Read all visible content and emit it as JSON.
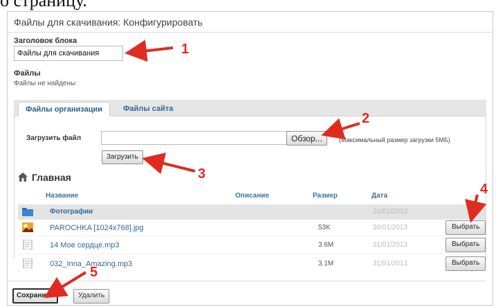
{
  "top_text": "о страницу.",
  "dialog": {
    "title": "Файлы для скачивания: Конфигурировать",
    "block_title_label": "Заголовок блока",
    "block_title_value": "Файлы для скачивания",
    "files_label": "Файлы",
    "files_none": "Файлы не найдены"
  },
  "tabs": [
    {
      "label": "Файлы организации",
      "active": true
    },
    {
      "label": "Файлы сайта",
      "active": false
    }
  ],
  "upload": {
    "label": "Загрузить файл",
    "browse_button": "Обзор...",
    "max_size_note": "(Максимальный размер загрузки 5МБ)",
    "upload_button": "Загрузить"
  },
  "folder_heading": "Главная",
  "table": {
    "headers": {
      "name": "Название",
      "description": "Описание",
      "size": "Размер",
      "date": "Дата"
    },
    "rows": [
      {
        "type": "folder",
        "icon": "folder-icon",
        "name": "Фотографии",
        "size": "",
        "date": "31/01/2013",
        "action": ""
      },
      {
        "type": "image",
        "icon": "image-icon",
        "name": "PAROCHKA [1024x768].jpg",
        "size": "53K",
        "date": "30/01/2013",
        "action": "Выбрать"
      },
      {
        "type": "audio",
        "icon": "file-icon",
        "name": "14 Мое сердце.mp3",
        "size": "3.6M",
        "date": "31/01/2013",
        "action": "Выбрать"
      },
      {
        "type": "audio",
        "icon": "file-icon",
        "name": "032_Inna_Amazing.mp3",
        "size": "3.1M",
        "date": "31/01/2013",
        "action": "Выбрать"
      }
    ]
  },
  "footer": {
    "save_button": "Сохранить",
    "delete_button": "Удалить"
  },
  "annotations": [
    "1",
    "2",
    "3",
    "4",
    "5"
  ],
  "colors": {
    "link": "#336699",
    "annotation": "#e02b20",
    "folder_row": "#e3e3e3"
  }
}
